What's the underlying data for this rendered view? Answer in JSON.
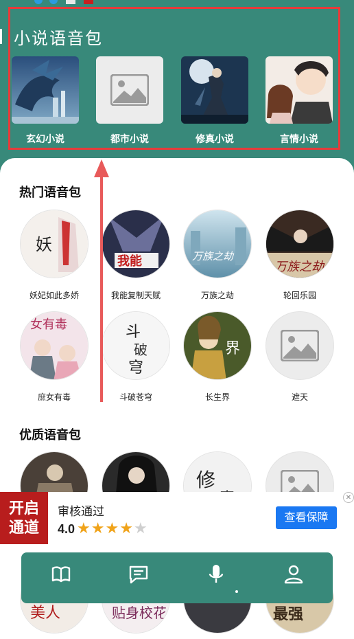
{
  "novel_section": {
    "title": "小说语音包",
    "items": [
      {
        "label": "玄幻小说"
      },
      {
        "label": "都市小说"
      },
      {
        "label": "修真小说"
      },
      {
        "label": "言情小说"
      }
    ]
  },
  "hot_section": {
    "title": "热门语音包",
    "items": [
      {
        "label": "妖妃如此多娇"
      },
      {
        "label": "我能复制天赋"
      },
      {
        "label": "万族之劫"
      },
      {
        "label": "轮回乐园"
      },
      {
        "label": "庶女有毒"
      },
      {
        "label": "斗破苍穹"
      },
      {
        "label": "长生界"
      },
      {
        "label": "遮天"
      }
    ]
  },
  "quality_section": {
    "title": "优质语音包"
  },
  "ad": {
    "logo_line1": "开启",
    "logo_line2": "通道",
    "name": "审核通过",
    "rating": "4.0",
    "stars_filled": 4,
    "stars_total": 5,
    "button": "查看保障"
  },
  "nav": {
    "items": [
      {
        "icon": "book-icon"
      },
      {
        "icon": "message-icon"
      },
      {
        "icon": "microphone-icon"
      },
      {
        "icon": "user-icon"
      }
    ],
    "active_index": 2
  },
  "colors": {
    "theme": "#38897a",
    "highlight_border": "#e83a3a",
    "ad_button": "#1a78f2",
    "star": "#f0a31a"
  }
}
